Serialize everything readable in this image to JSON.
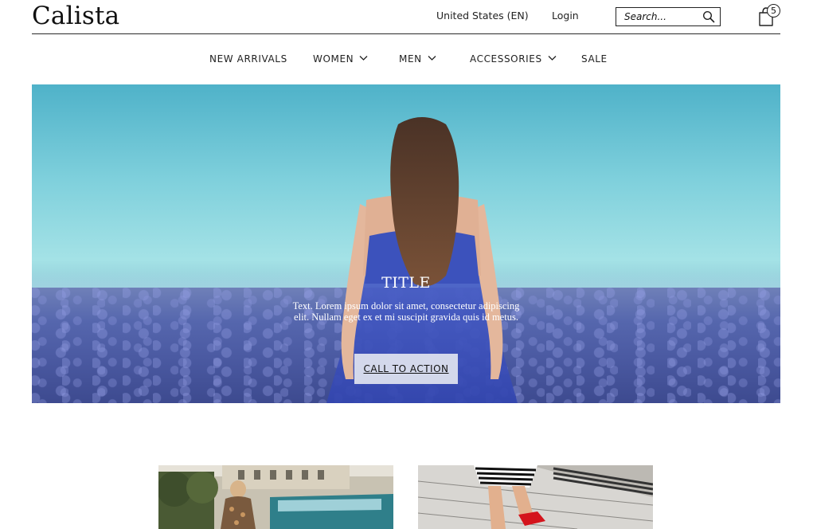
{
  "header": {
    "logo": "Calista",
    "region": "United States (EN)",
    "login": "Login",
    "search_placeholder": "Search...",
    "cart_count": "5"
  },
  "nav": {
    "items": [
      {
        "label": "NEW ARRIVALS",
        "has_dropdown": false
      },
      {
        "label": "WOMEN",
        "has_dropdown": true
      },
      {
        "label": "MEN",
        "has_dropdown": true
      },
      {
        "label": "ACCESSORIES",
        "has_dropdown": true
      },
      {
        "label": "SALE",
        "has_dropdown": false
      }
    ]
  },
  "hero": {
    "title": "TITLE",
    "text": "Text. Lorem ipsum dolor sit amet, consectetur adipiscing elit. Nullam eget ex et mi suscipit gravida quis id metus.",
    "cta_label": "CALL TO ACTION"
  },
  "colors": {
    "text": "#111111",
    "sky": "#8fd6df",
    "field": "#4b5aa2",
    "dress": "#3f55c0",
    "cta_bg": "#e1e4f0"
  },
  "tiles": [
    {
      "name": "street-style-photo"
    },
    {
      "name": "red-shoes-photo"
    }
  ]
}
